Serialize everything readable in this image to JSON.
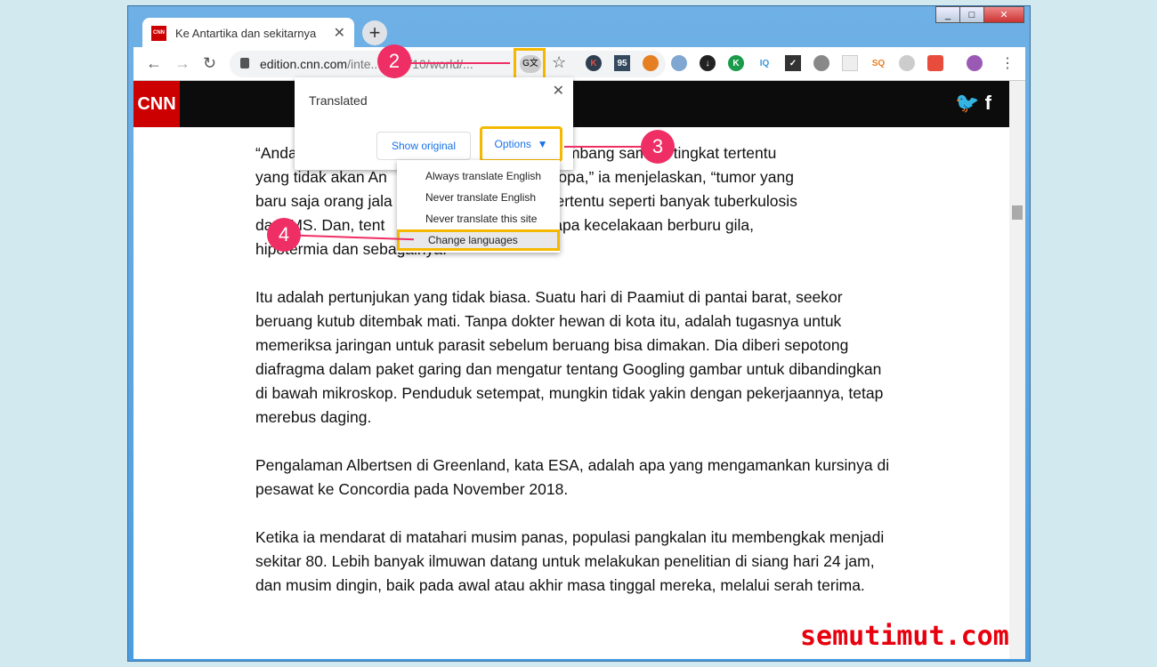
{
  "tab": {
    "title": "Ke Antartika dan sekitarnya",
    "favicon": "CNN"
  },
  "url": {
    "host": "edition.cnn.com",
    "path": "/inte...2019/10/world/..."
  },
  "site": {
    "logo": "CNN"
  },
  "popup": {
    "title": "Translated",
    "show_original": "Show original",
    "options": "Options"
  },
  "menu": [
    "Always translate English",
    "Never translate English",
    "Never translate this site",
    "Change languages"
  ],
  "steps": [
    "2",
    "3",
    "4"
  ],
  "article": {
    "p1": [
      "“Anda",
      "n berkembang sampai tingkat tertentu",
      "yang tidak akan An",
      "ara Eropa,” ia menjelaskan, “tumor yang",
      "baru saja orang jala",
      "ular tertentu seperti banyak tuberkulosis",
      "da",
      "MS. Dan, tent",
      "eberapa kecelakaan berburu gila,",
      "hipotermia dan sebagainya."
    ],
    "p2": "Itu adalah pertunjukan yang tidak biasa. Suatu hari di Paamiut di pantai barat, seekor beruang kutub ditembak mati. Tanpa dokter hewan di kota itu, adalah tugasnya untuk memeriksa jaringan untuk parasit sebelum beruang bisa dimakan. Dia diberi sepotong diafragma dalam paket garing dan mengatur tentang Googling gambar untuk dibandingkan di bawah mikroskop. Penduduk setempat, mungkin tidak yakin dengan pekerjaannya, tetap merebus daging.",
    "p3": "Pengalaman Albertsen di Greenland, kata ESA, adalah apa yang mengamankan kursinya di pesawat ke Concordia pada November 2018.",
    "p4": "Ketika ia mendarat di matahari musim panas, populasi pangkalan itu membengkak menjadi sekitar 80. Lebih banyak ilmuwan datang untuk melakukan penelitian di siang hari 24 jam, dan musim dingin, baik pada awal atau akhir masa tinggal mereka, melalui serah terima."
  },
  "watermark": "semutimut.com",
  "colors": {
    "highlight": "#f5b800",
    "badge": "#ee2e64",
    "cnn": "#cc0000"
  }
}
